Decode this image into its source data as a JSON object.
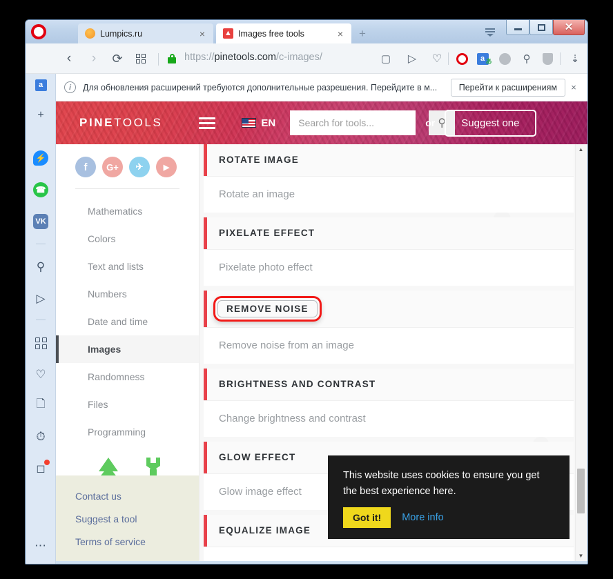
{
  "browser": {
    "name": "Opera",
    "tabs": [
      {
        "title": "Lumpics.ru",
        "favicon": "orange-circle-icon",
        "active": false,
        "close": "×"
      },
      {
        "title": "Images free tools",
        "favicon": "pine-tree-icon",
        "active": true,
        "close": "×"
      }
    ],
    "new_tab_label": "+",
    "window_controls": {
      "menu": "window-menu",
      "minimize": "–",
      "maximize": "□",
      "close": "✕"
    },
    "nav": {
      "back": "‹",
      "forward": "›",
      "reload": "⟳",
      "speed_dial": "speed-dial-icon",
      "lock": "secure-lock-icon",
      "url_scheme": "https://",
      "url_host": "pinetools.com",
      "url_path": "/c-images/"
    },
    "toolbar_right": [
      "snapshot-icon",
      "send-icon",
      "heart-icon",
      "opera-icon",
      "translate-icon",
      "globe-icon",
      "search-page-icon",
      "shield-icon",
      "download-icon",
      "easy-setup-icon"
    ],
    "sidepanel": [
      "messenger-icon",
      "whatsapp-icon",
      "vk-icon",
      "divider",
      "search-icon",
      "send-icon",
      "divider",
      "apps-icon",
      "heart-icon",
      "news-icon",
      "history-icon",
      "extensions-icon",
      "more-icon"
    ],
    "sidepanel_add": "+",
    "sidepanel_translate": "translate-icon"
  },
  "notification": {
    "icon": "info-icon",
    "message": "Для обновления расширений требуются дополнительные разрешения. Перейдите в м...",
    "button": "Перейти к расширениям",
    "close": "×"
  },
  "site": {
    "header": {
      "logo_bold": "PINE",
      "logo_light": "TOOLS",
      "menu_icon": "hamburger-icon",
      "flag": "us-flag-icon",
      "language": "EN",
      "search_placeholder": "Search for tools...",
      "search_value": "",
      "search_icon": "search-icon",
      "or_label": "or",
      "suggest_button": "Suggest one",
      "accent_left": "#e0434b",
      "accent_right": "#9c1b5c"
    },
    "sidebar": {
      "socials": [
        {
          "name": "facebook-icon",
          "glyph": "f"
        },
        {
          "name": "google-plus-icon",
          "glyph": "G+"
        },
        {
          "name": "twitter-icon",
          "glyph": "✈"
        },
        {
          "name": "youtube-icon",
          "glyph": "▶"
        }
      ],
      "items": [
        {
          "label": "Mathematics",
          "active": false
        },
        {
          "label": "Colors",
          "active": false
        },
        {
          "label": "Text and lists",
          "active": false
        },
        {
          "label": "Numbers",
          "active": false
        },
        {
          "label": "Date and time",
          "active": false
        },
        {
          "label": "Images",
          "active": true
        },
        {
          "label": "Randomness",
          "active": false
        },
        {
          "label": "Files",
          "active": false
        },
        {
          "label": "Programming",
          "active": false
        }
      ],
      "graphic": [
        "pine-tree-icon",
        "wrench-icon"
      ],
      "footer_links": [
        "Contact us",
        "Suggest a tool",
        "Terms of service"
      ]
    },
    "tools": [
      {
        "title": "ROTATE IMAGE",
        "desc": "Rotate an image",
        "highlighted": false
      },
      {
        "title": "PIXELATE EFFECT",
        "desc": "Pixelate photo effect",
        "highlighted": false
      },
      {
        "title": "REMOVE NOISE",
        "desc": "Remove noise from an image",
        "highlighted": true
      },
      {
        "title": "BRIGHTNESS AND CONTRAST",
        "desc": "Change brightness and contrast",
        "highlighted": false
      },
      {
        "title": "GLOW EFFECT",
        "desc": "Glow image effect",
        "highlighted": false
      },
      {
        "title": "EQUALIZE IMAGE",
        "desc": "",
        "highlighted": false
      }
    ],
    "scrollbar": {
      "up": "▲",
      "down": "▼"
    },
    "cookie": {
      "text": "This website uses cookies to ensure you get the best experience here.",
      "accept": "Got it!",
      "more": "More info",
      "accept_color": "#efd81c",
      "link_color": "#3aa3e8"
    }
  }
}
